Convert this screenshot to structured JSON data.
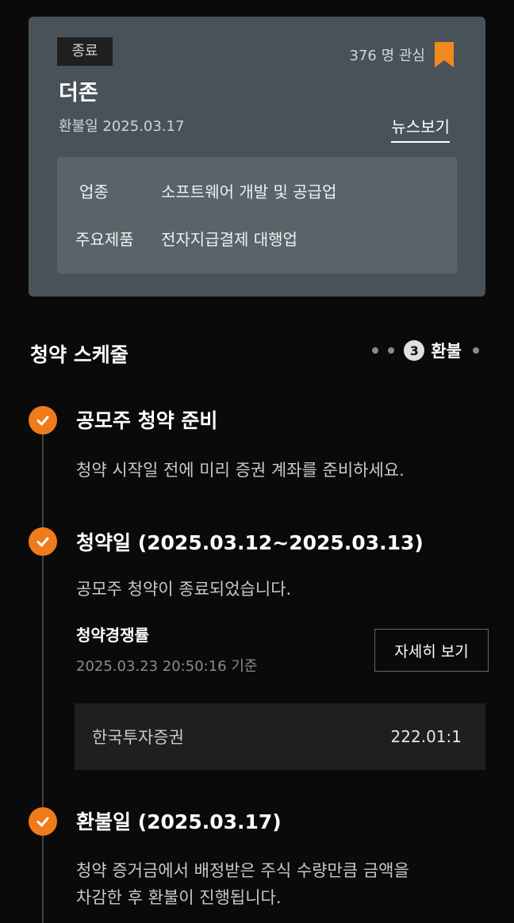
{
  "card": {
    "status_badge": "종료",
    "interest_count": "376 명 관심",
    "company_name": "더존",
    "refund_date": "환불일 2025.03.17",
    "news_link": "뉴스보기",
    "info": [
      {
        "key": "업종",
        "value": "소프트웨어 개발 및 공급업"
      },
      {
        "key": "주요제품",
        "value": "전자지급결제 대행업"
      }
    ]
  },
  "schedule": {
    "title": "청약 스케줄",
    "current_step_number": "3",
    "current_step_label": "환불",
    "steps": [
      {
        "title": "공모주 청약 준비",
        "desc": "청약 시작일 전에 미리 증권 계좌를 준비하세요."
      },
      {
        "title": "청약일 (2025.03.12~2025.03.13)",
        "desc": "공모주 청약이 종료되었습니다."
      },
      {
        "title": "환불일 (2025.03.17)",
        "desc_line1": "청약 증거금에서 배정받은 주식 수량만큼 금액을",
        "desc_line2": "차감한 후 환불이 진행됩니다."
      }
    ],
    "competition": {
      "label": "청약경쟁률",
      "timestamp": "2025.03.23 20:50:16 기준",
      "detail_button": "자세히 보기",
      "brokers": [
        {
          "name": "한국투자증권",
          "ratio": "222.01:1"
        }
      ]
    }
  },
  "colors": {
    "accent_orange": "#f07b1a",
    "card_bg": "#4a5259",
    "info_bg": "#5a6369"
  }
}
